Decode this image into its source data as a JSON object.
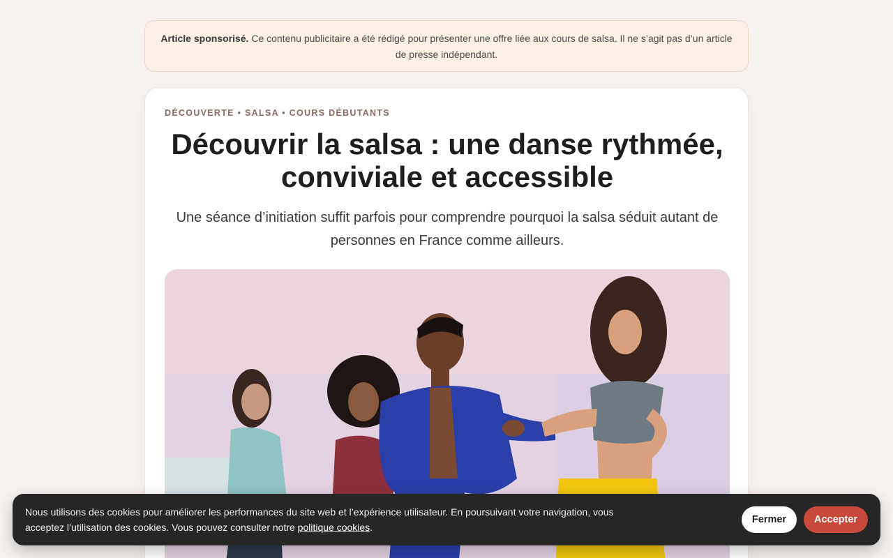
{
  "sponsor_banner": {
    "label": "Article sponsorisé.",
    "text": " Ce contenu publicitaire a été rédigé pour présenter une offre liée aux cours de salsa. Il ne s’agit pas d’un article de presse indépendant."
  },
  "article": {
    "kicker": "DÉCOUVERTE • SALSA • COURS DÉBUTANTS",
    "title": "Découvrir la salsa : une danse rythmée, conviviale et accessible",
    "subtitle": "Une séance d’initiation suffit parfois pour comprendre pourquoi la salsa séduit autant de personnes en France comme ailleurs.",
    "image_icon": "salsa-dancers-photo"
  },
  "cookie_banner": {
    "text_before": "Nous utilisons des cookies pour améliorer les performances du site web et l’expérience utilisateur. En poursuivant votre navigation, vous acceptez l’utilisation des cookies. Vous pouvez consulter notre ",
    "link_label": "politique cookies",
    "text_after": ".",
    "close_label": "Fermer",
    "accept_label": "Accepter"
  },
  "colors": {
    "page_background": "#f8f3f0",
    "sponsor_background": "#fdf1e6",
    "kicker": "#8a6a60",
    "cookie_background": "#262626",
    "accept_button": "#c94a3a"
  }
}
